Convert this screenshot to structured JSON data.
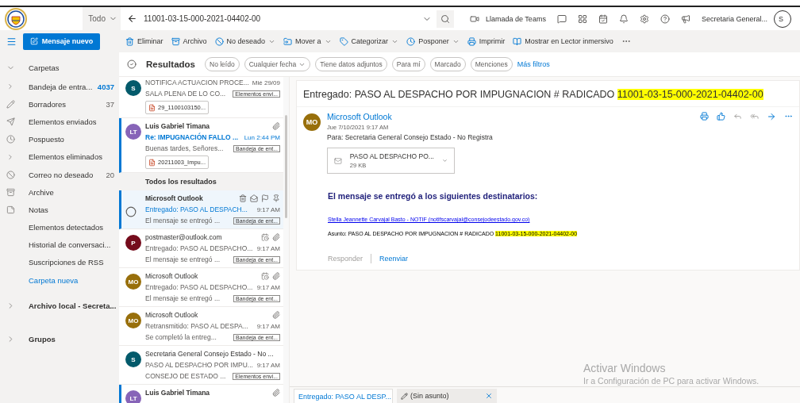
{
  "header": {
    "scope": "Todo",
    "search_value": "11001-03-15-000-2021-04402-00",
    "teams_call": "Llamada de Teams",
    "account": "Secretaria General...",
    "account_initial": "S"
  },
  "sidebar": {
    "new_message": "Mensaje nuevo",
    "folders_header": {
      "label": "Carpetas",
      "expanded": true
    },
    "folders": [
      {
        "label": "Bandeja de entra...",
        "count": {
          "value": "4037",
          "unread": true
        },
        "expandable": true
      },
      {
        "label": "Borradores",
        "count": {
          "value": "37",
          "unread": false
        },
        "expandable": false
      },
      {
        "label": "Elementos enviados",
        "expandable": false
      },
      {
        "label": "Pospuesto",
        "expandable": false
      },
      {
        "label": "Elementos eliminados",
        "expandable": true
      },
      {
        "label": "Correo no deseado",
        "count": {
          "value": "20",
          "unread": false
        },
        "expandable": false
      },
      {
        "label": "Archive",
        "expandable": false
      },
      {
        "label": "Notas",
        "expandable": false
      },
      {
        "label": "Elementos detectados",
        "expandable": false
      },
      {
        "label": "Historial de conversaci...",
        "expandable": false
      },
      {
        "label": "Suscripciones de RSS",
        "expandable": false
      }
    ],
    "new_folder": "Carpeta nueva",
    "groups": [
      {
        "label": "Archivo local - Secreta...",
        "expanded": false
      },
      {
        "label": "Grupos",
        "expanded": false
      }
    ]
  },
  "commands": [
    {
      "label": "Eliminar",
      "has_menu": false
    },
    {
      "label": "Archivo",
      "has_menu": false
    },
    {
      "label": "No deseado",
      "has_menu": true
    },
    {
      "label": "Mover a",
      "has_menu": true
    },
    {
      "label": "Categorizar",
      "has_menu": true
    },
    {
      "label": "Posponer",
      "has_menu": true
    },
    {
      "label": "Imprimir",
      "has_menu": false
    },
    {
      "label": "Mostrar en Lector inmersivo",
      "has_menu": false
    }
  ],
  "filters": {
    "title": "Resultados",
    "chips": [
      {
        "label": "No leído",
        "has_menu": false,
        "selected": false
      },
      {
        "label": "Cualquier fecha",
        "has_menu": true,
        "selected": false
      },
      {
        "label": "Tiene datos adjuntos",
        "has_menu": false,
        "selected": false
      },
      {
        "label": "Para mí",
        "has_menu": false,
        "selected": false
      },
      {
        "label": "Marcado",
        "has_menu": false,
        "selected": false
      },
      {
        "label": "Menciones",
        "has_menu": false,
        "selected": false
      }
    ],
    "more": "Más filtros"
  },
  "messages": {
    "top": [
      {
        "avatar": "S",
        "color": "#035a6b",
        "subject": "NOTIFICA ACTUACION PROCE...",
        "time": "Mié 29/09",
        "preview": "SALA PLENA DE LO CO...",
        "folder": "Elementos envi...",
        "attachment": "29_1100103150...",
        "unread": false,
        "selected": false
      },
      {
        "avatar": "LT",
        "color": "#8764b8",
        "sender": "Luis Gabriel Timana",
        "subject": "Re: IMPUGNACIÓN FALLO ...",
        "time": "Lun 2:44 PM",
        "preview": "Buenas tardes, Señores...",
        "folder": "Bandeja de ent...",
        "attachment": "20211003_Impu...",
        "unread": true,
        "selected": false,
        "has_clip": true,
        "has_meeting": false
      }
    ],
    "section": "Todos los resultados",
    "results": [
      {
        "sender": "Microsoft Outlook",
        "subject": "Entregado: PASO AL DESPACH...",
        "time": "9:17 AM",
        "preview": "El mensaje se entregó ...",
        "folder": "Bandeja de ent...",
        "unread": false,
        "selected": true
      },
      {
        "avatar": "P",
        "color": "#750b1c",
        "sender": "postmaster@outlook.com",
        "subject": "Entregado: PASO AL DESPACHO...",
        "time": "9:17 AM",
        "preview": "El mensaje se entregó ...",
        "folder": "Bandeja de ent...",
        "unread": false,
        "selected": false,
        "has_clip": true,
        "has_meeting": true
      },
      {
        "avatar": "MO",
        "color": "#986f0b",
        "sender": "Microsoft Outlook",
        "subject": "Entregado: PASO AL DESPACHO...",
        "time": "9:17 AM",
        "preview": "El mensaje se entregó ...",
        "folder": "Bandeja de ent...",
        "unread": false,
        "selected": false,
        "has_clip": true,
        "has_meeting": true
      },
      {
        "avatar": "MO",
        "color": "#986f0b",
        "sender": "Microsoft Outlook",
        "subject": "Retransmitido: PASO AL DESPA...",
        "time": "9:17 AM",
        "preview": "Se completó la entreg...",
        "folder": "Bandeja de ent...",
        "unread": false,
        "selected": false,
        "has_clip": true,
        "has_meeting": false
      },
      {
        "avatar": "S",
        "color": "#035a6b",
        "sender": "Secretaria General Consejo Estado - No ...",
        "subject": "PASO AL DESPACHO POR IMPU...",
        "time": "9:17 AM",
        "preview": "CONSEJO DE ESTADO ...",
        "folder": "Elementos envi...",
        "unread": false,
        "selected": false,
        "has_clip": false,
        "has_meeting": false
      },
      {
        "avatar": "LT",
        "color": "#8764b8",
        "sender": "Luis Gabriel Timana",
        "unread": true,
        "selected": false,
        "has_clip": true,
        "has_meeting": false
      }
    ]
  },
  "reading": {
    "subject": "Entregado: PASO AL DESPACHO POR IMPUGNACION # RADICADO",
    "subject_highlight": "11001-03-15-000-2021-04402-00",
    "sender": "Microsoft Outlook",
    "avatar": "MO",
    "color": "#986f0b",
    "date": "Jue 7/10/2021 9:17 AM",
    "to_label": "Para:",
    "to": "Secretaria General Consejo Estado - No Registra",
    "attachment": {
      "name": "PASO AL DESPACHO PO...",
      "size": "29 KB"
    },
    "body_heading": "El mensaje se entregó a los siguientes destinatarios:",
    "recipient": "Stella Jeannette Carvajal Basto - NOTIF (notifscarvajal@consejodeestado.gov.co)",
    "asunto": "Asunto: PASO AL DESPACHO POR IMPUGNACION # RADICADO",
    "asunto_highlight": "11001-03-15-000-2021-04402-00",
    "actions": [
      {
        "label": "Responder",
        "disabled": true
      },
      {
        "label": "Reenviar",
        "disabled": false
      }
    ]
  },
  "tabs": [
    {
      "label": "Entregado: PASO AL DESP...",
      "kind": "message",
      "selected": true
    },
    {
      "label": "(Sin asunto)",
      "kind": "draft",
      "selected": false
    }
  ],
  "activation": {
    "title": "Activar Windows",
    "subtitle": "Ir a Configuración de PC para activar Windows."
  }
}
